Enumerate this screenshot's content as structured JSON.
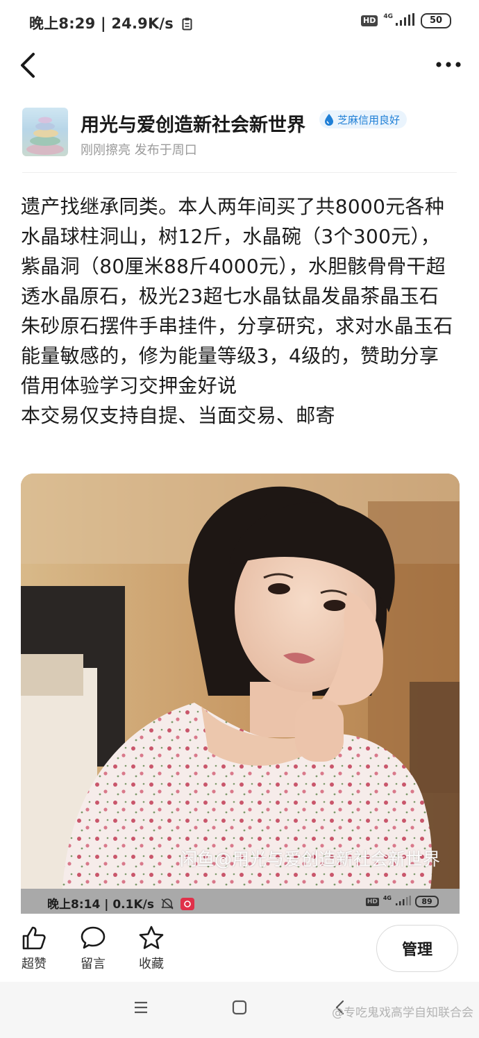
{
  "status_bar": {
    "time_text": "晚上8:29 | 24.9K/s",
    "network": "4G",
    "battery": "50"
  },
  "nav": {
    "back_icon": "chevron-left-icon",
    "more_icon": "more-horizontal-icon"
  },
  "seller": {
    "name": "用光与爱创造新社会新世界",
    "credit_badge": "芝麻信用良好",
    "subtitle": "刚刚擦亮 发布于周口"
  },
  "description": "遗产找继承同类。本人两年间买了共8000元各种水晶球柱洞山，树12斤，水晶碗（3个300元），紫晶洞（80厘米88斤4000元），水胆骸骨骨干超透水晶原石，极光23超七水晶钛晶发晶茶晶玉石朱砂原石摆件手串挂件，分享研究，求对水晶玉石能量敏感的，修为能量等级3，4级的，赞助分享借用体验学习交押金好说\n本交易仅支持自提、当面交易、邮寄",
  "photo": {
    "watermark": "闲鱼@用光与爱创造新社会新世界",
    "embedded_status": {
      "time_text": "晚上8:14 | 0.1K/s",
      "network": "4G",
      "battery": "89"
    }
  },
  "actions": {
    "like": "超赞",
    "comment": "留言",
    "favorite": "收藏",
    "manage": "管理"
  },
  "footer": {
    "watermark": "@专吃鬼戏高学自知联合会"
  },
  "colors": {
    "badge_blue": "#1f7fd6",
    "text": "#1c1c1c",
    "muted": "#9a9a9a"
  }
}
